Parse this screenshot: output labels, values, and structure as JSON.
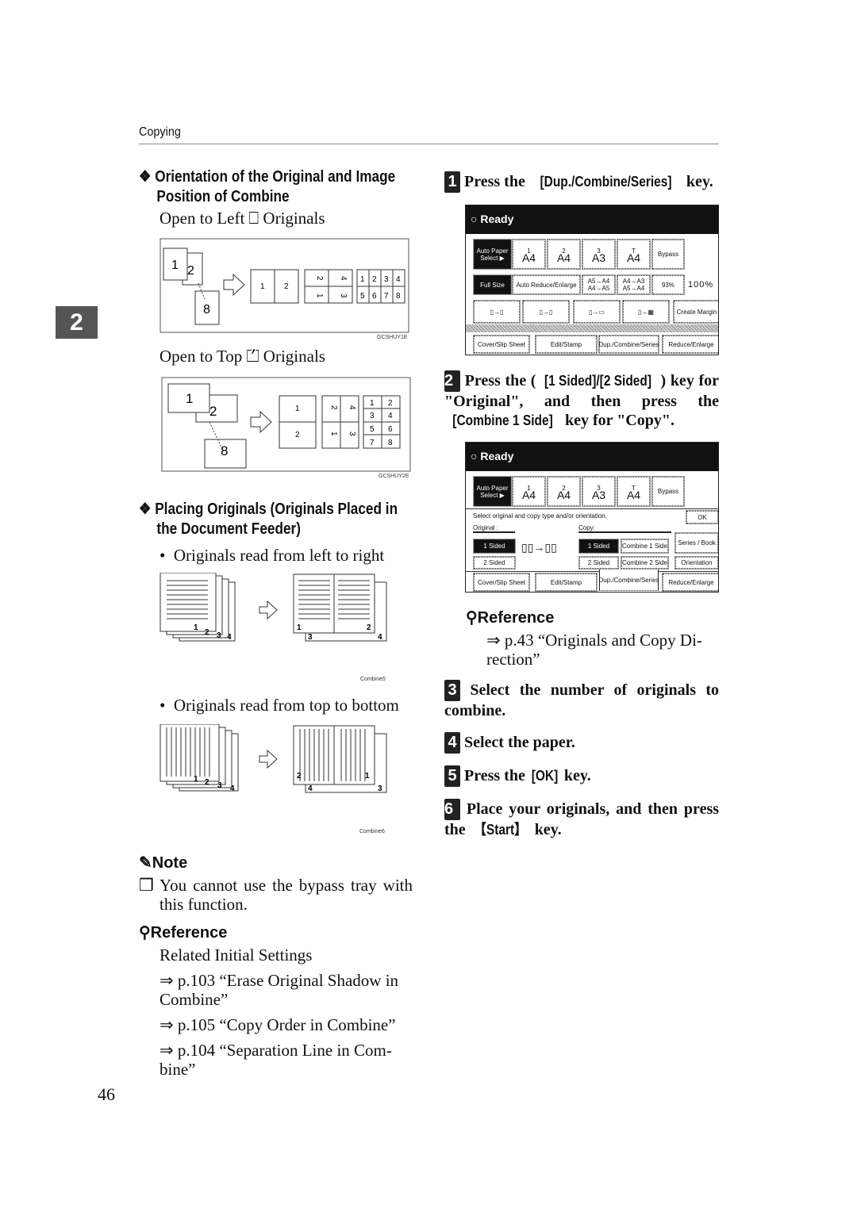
{
  "header": {
    "section": "Copying",
    "chapter": "2",
    "page_number": "46"
  },
  "left": {
    "orientation": {
      "title_line1": "Orientation of the Original and Image",
      "title_line2": "Position of Combine",
      "open_left": "Open to Left",
      "open_left_suffix": "Originals",
      "open_top": "Open to Top",
      "open_top_suffix": "Originals",
      "fig1_code": "GCSHUY1E",
      "fig2_code": "GCSHUY2E",
      "digits": [
        "1",
        "2",
        "8",
        "1",
        "2",
        "2",
        "4",
        "1",
        "3",
        "1",
        "2",
        "3",
        "4",
        "5",
        "6",
        "7",
        "8"
      ]
    },
    "placing": {
      "title_line1": "Placing Originals (Originals Placed in",
      "title_line2": "the Document Feeder)",
      "bullet1": "Originals read from left to right",
      "fig3_code": "Combine5",
      "bullet2": "Originals read from top to bottom",
      "fig4_code": "Combine6"
    },
    "note": {
      "title": "Note",
      "item": "You cannot use the bypass tray with this function."
    },
    "reference": {
      "title": "Reference",
      "intro": "Related Initial Settings",
      "links": [
        "⇒ p.103 “Erase Original Shadow in Combine”",
        "⇒ p.105 “Copy Order in Combine”",
        "⇒ p.104 “Separation Line in Com-bine”"
      ]
    }
  },
  "right": {
    "steps": [
      {
        "num": "1",
        "pre": "Press the ",
        "key": "[Dup./Combine/Series]",
        "post": " key."
      },
      {
        "num": "2",
        "text_a": "Press the (",
        "key_a": "[1 Sided]/[2 Sided]",
        "text_b": ") key for \"Original\", and then press the ",
        "key_b": "[Combine 1 Side]",
        "text_c": " key for \"Copy\"."
      },
      {
        "num": "3",
        "text": "Select the number of originals to combine."
      },
      {
        "num": "4",
        "text": "Select the paper."
      },
      {
        "num": "5",
        "pre": "Press the ",
        "key": "[OK]",
        "post": " key."
      },
      {
        "num": "6",
        "pre": "Place your originals, and then press the ",
        "key": "【Start】",
        "post": " key."
      }
    ],
    "reference": {
      "title": "Reference",
      "link": "⇒ p.43 “Originals and Copy Di-rection”"
    },
    "panel": {
      "status": "Ready",
      "auto_paper": "Auto Paper Select ▶",
      "trays": [
        {
          "label": "1",
          "size": "A4"
        },
        {
          "label": "2",
          "size": "A4"
        },
        {
          "label": "3",
          "size": "A3"
        },
        {
          "label": "T",
          "size": "A4"
        }
      ],
      "bypass": "Bypass",
      "full_size": "Full Size",
      "auto_reduce": "Auto Reduce/Enlarge",
      "r1": "A5→A4 A4→A5",
      "r2": "A4→A3 A5→A4",
      "pct": "93%",
      "current_ratio": "100%",
      "create_margin": "Create Margin",
      "tabs": [
        "Cover/Slip Sheet",
        "Edit/Stamp",
        "Dup./Combine/Series",
        "Reduce/Enlarge"
      ],
      "instruction": "Select original and copy type and/or orientation.",
      "ok": "OK",
      "original_label": "Original :",
      "copy_label": "Copy:",
      "orig_1": "1 Sided",
      "orig_2": "2 Sided",
      "copy_1": "1 Sided",
      "copy_2": "2 Sided",
      "combine_1": "Combine 1 Side",
      "combine_2": "Combine 2 Side",
      "series_book": "Series / Book",
      "orientation": "Orientation"
    }
  }
}
